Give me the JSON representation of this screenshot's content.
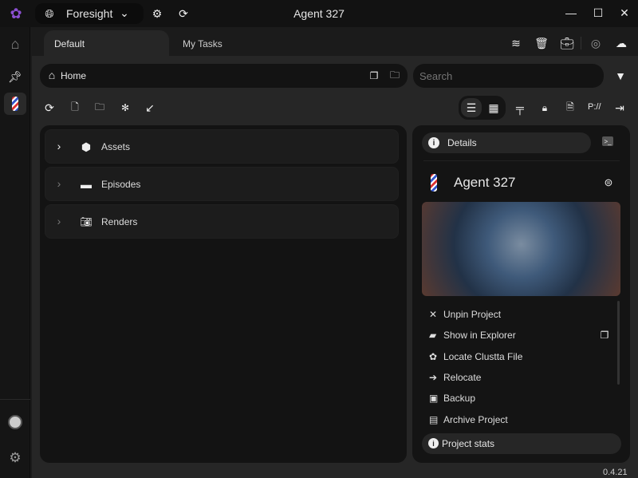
{
  "titlebar": {
    "workspace": "Foresight",
    "title": "Agent 327"
  },
  "tabs": [
    {
      "label": "Default",
      "active": true
    },
    {
      "label": "My Tasks",
      "active": false
    }
  ],
  "breadcrumb": {
    "label": "Home"
  },
  "search": {
    "placeholder": "Search",
    "value": ""
  },
  "toolbar": {
    "path_button": "P://"
  },
  "tree": [
    {
      "label": "Assets",
      "icon": "cube-icon"
    },
    {
      "label": "Episodes",
      "icon": "folder-icon"
    },
    {
      "label": "Renders",
      "icon": "camera-icon"
    }
  ],
  "details": {
    "tab_label": "Details",
    "project_name": "Agent 327",
    "actions": [
      {
        "label": "Unpin Project",
        "icon": "unpin-icon"
      },
      {
        "label": "Show in Explorer",
        "icon": "folder-open-icon"
      },
      {
        "label": "Locate Clustta File",
        "icon": "locate-icon"
      },
      {
        "label": "Relocate",
        "icon": "relocate-icon"
      },
      {
        "label": "Backup",
        "icon": "backup-icon"
      },
      {
        "label": "Archive Project",
        "icon": "archive-icon"
      }
    ],
    "stats_label": "Project stats"
  },
  "version": "0.4.21",
  "colors": {
    "accent": "#7b3fbf",
    "bg": "#111111",
    "panel": "#262626"
  }
}
